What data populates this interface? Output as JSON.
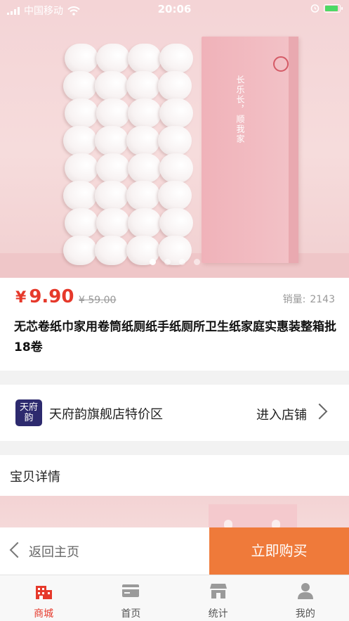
{
  "status_bar": {
    "carrier": "中国移动",
    "time": "20:06"
  },
  "hero": {
    "box_text": "长乐长，顺我家",
    "slide_count": 4,
    "active_slide": 1
  },
  "product": {
    "currency": "¥",
    "price": "9.90",
    "original_price": "¥ 59.00",
    "sales_label": "销量:",
    "sales_count": "2143",
    "title": "无芯卷纸巾家用卷筒纸厕纸手纸厕所卫生纸家庭实惠装整箱批18卷"
  },
  "shop": {
    "logo_text": "天府韵",
    "name": "天府韵旗舰店特价区",
    "enter_label": "进入店铺"
  },
  "detail": {
    "header": "宝贝详情"
  },
  "actions": {
    "back_label": "返回主页",
    "buy_label": "立即购买"
  },
  "tabs": [
    {
      "label": "商城",
      "icon": "store-icon",
      "active": true
    },
    {
      "label": "首页",
      "icon": "card-icon",
      "active": false
    },
    {
      "label": "统计",
      "icon": "stats-icon",
      "active": false
    },
    {
      "label": "我的",
      "icon": "user-icon",
      "active": false
    }
  ],
  "colors": {
    "price": "#e6392b",
    "buy_button": "#ef7a3a",
    "active_tab": "#e6392b",
    "inactive_tab_icon": "#9a9a9a"
  }
}
